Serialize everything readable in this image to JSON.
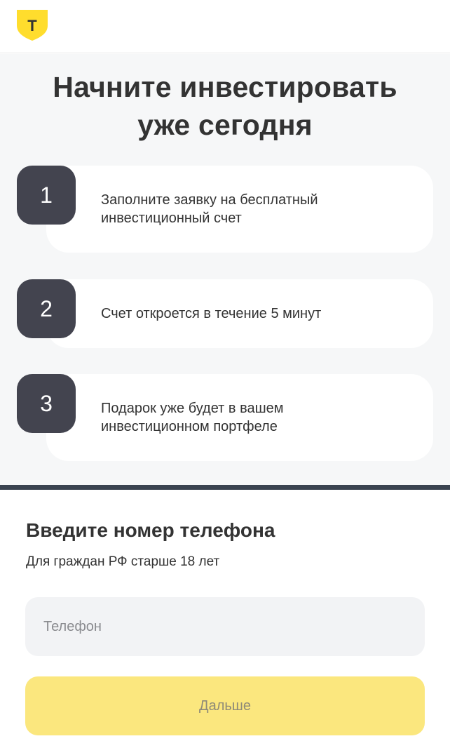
{
  "header": {
    "logo_letter": "T",
    "logo_color": "#ffdd2d"
  },
  "steps_section": {
    "title_line1": "Начните инвестировать",
    "title_line2": "уже сегодня",
    "steps": [
      {
        "number": "1",
        "line1": "Заполните заявку на бесплатный",
        "line2": "инвестиционный счет"
      },
      {
        "number": "2",
        "line1": "Счет откроется в течение 5 минут",
        "line2": ""
      },
      {
        "number": "3",
        "line1": "Подарок уже будет в вашем",
        "line2": "инвестиционном портфеле"
      }
    ]
  },
  "form": {
    "title": "Введите номер телефона",
    "subtitle": "Для граждан РФ старше 18 лет",
    "phone_placeholder": "Телефон",
    "phone_value": "",
    "next_label": "Дальше"
  },
  "colors": {
    "accent_yellow": "#ffdd2d",
    "button_yellow": "#fbe77e",
    "step_badge": "#43444f",
    "divider": "#3a4350"
  }
}
